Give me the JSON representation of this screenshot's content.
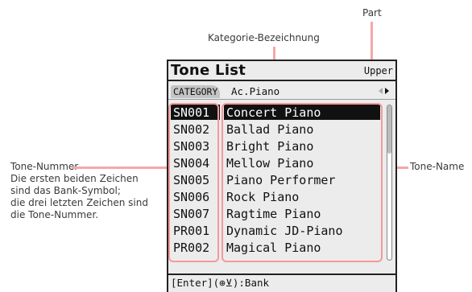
{
  "annotations": {
    "part_label": "Part",
    "category_label": "Kategorie-Bezeichnung",
    "tone_name_label": "Tone-Name",
    "tone_number_lines": [
      "Tone-Nummer",
      "Die ersten beiden Zeichen",
      "sind das Bank-Symbol;",
      "die drei letzten Zeichen sind",
      "die Tone-Nummer."
    ]
  },
  "screen": {
    "title": "Tone List",
    "part": "Upper",
    "category_tab": "CATEGORY",
    "category_value": "Ac.Piano",
    "footer": "[Enter](⊕⊻):Bank",
    "tones": [
      {
        "number": "SN001",
        "name": "Concert Piano",
        "selected": true
      },
      {
        "number": "SN002",
        "name": "Ballad Piano"
      },
      {
        "number": "SN003",
        "name": "Bright Piano"
      },
      {
        "number": "SN004",
        "name": "Mellow Piano"
      },
      {
        "number": "SN005",
        "name": "Piano Performer"
      },
      {
        "number": "SN006",
        "name": "Rock Piano"
      },
      {
        "number": "SN007",
        "name": "Ragtime Piano"
      },
      {
        "number": "PR001",
        "name": "Dynamic JD-Piano"
      },
      {
        "number": "PR002",
        "name": "Magical Piano"
      }
    ]
  },
  "colors": {
    "highlight": "#f39a9a",
    "screen_bg": "#ececec"
  }
}
